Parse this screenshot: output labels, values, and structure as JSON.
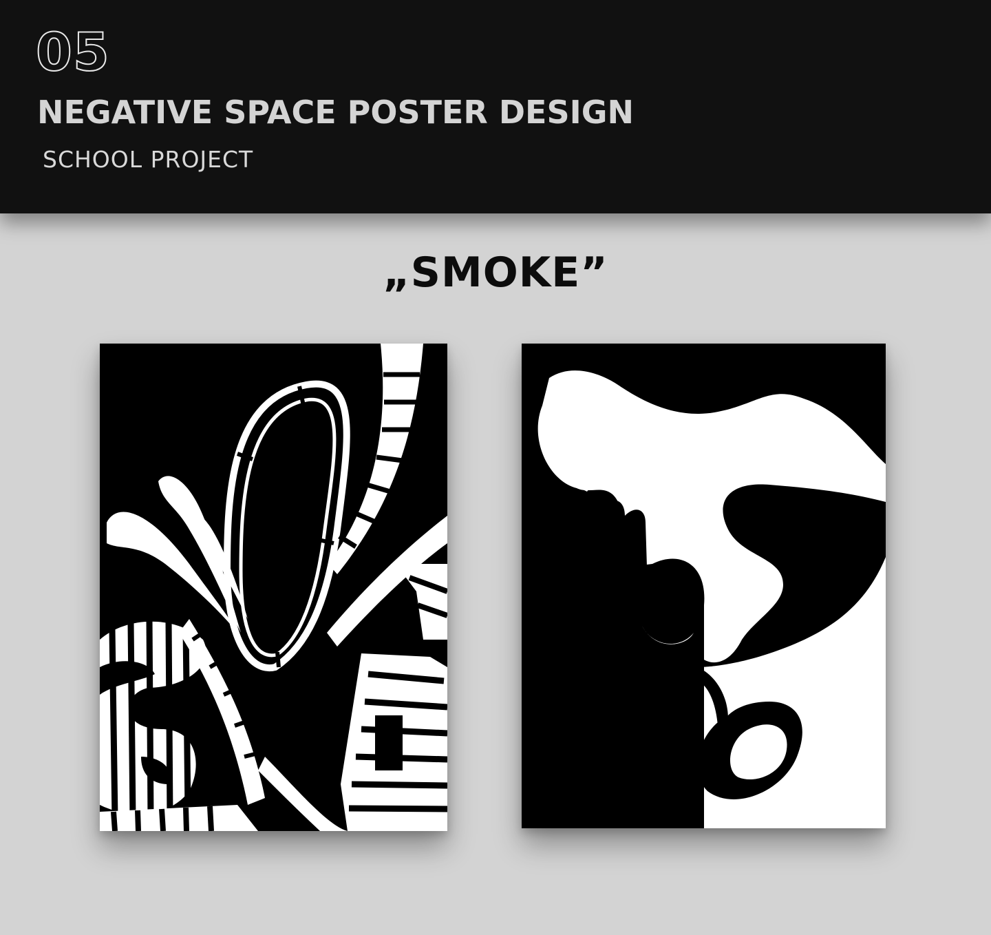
{
  "header": {
    "number": "05",
    "title": "NEGATIVE SPACE POSTER DESIGN",
    "subtitle": "SCHOOL PROJECT"
  },
  "showcase": {
    "poster_title": "„SMOKE”",
    "posters": [
      {
        "artwork": "graffiti-lettering-artwork"
      },
      {
        "artwork": "smoke-hand-artwork"
      }
    ]
  },
  "colors": {
    "header_bg": "#111111",
    "page_bg": "#d3d3d3",
    "poster_black": "#000000",
    "poster_white": "#ffffff"
  }
}
